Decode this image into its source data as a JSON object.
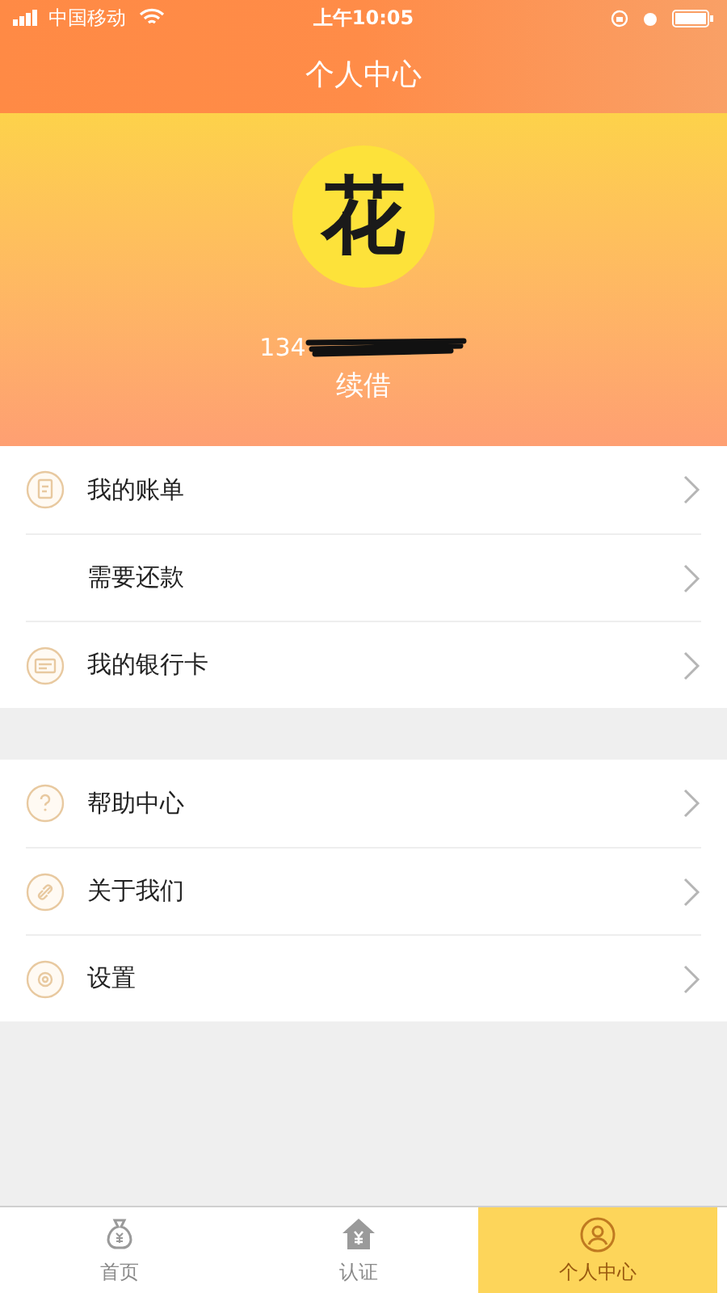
{
  "status_bar": {
    "carrier": "中国移动",
    "time": "上午10:05"
  },
  "header": {
    "title": "个人中心"
  },
  "profile": {
    "avatar_text": "花",
    "phone": "134",
    "action": "续借"
  },
  "menu_groups": [
    {
      "items": [
        {
          "label": "我的账单",
          "kind": "bill"
        },
        {
          "label": "需要还款",
          "kind": "plain"
        },
        {
          "label": "我的银行卡",
          "kind": "card"
        }
      ]
    },
    {
      "items": [
        {
          "label": "帮助中心",
          "kind": "help"
        },
        {
          "label": "关于我们",
          "kind": "link"
        },
        {
          "label": "设置",
          "kind": "settings"
        }
      ]
    }
  ],
  "tab_bar": [
    {
      "label": "首页",
      "kind": "bag",
      "selected": false
    },
    {
      "label": "认证",
      "kind": "house",
      "selected": false
    },
    {
      "label": "个人中心",
      "kind": "person",
      "selected": true
    }
  ]
}
